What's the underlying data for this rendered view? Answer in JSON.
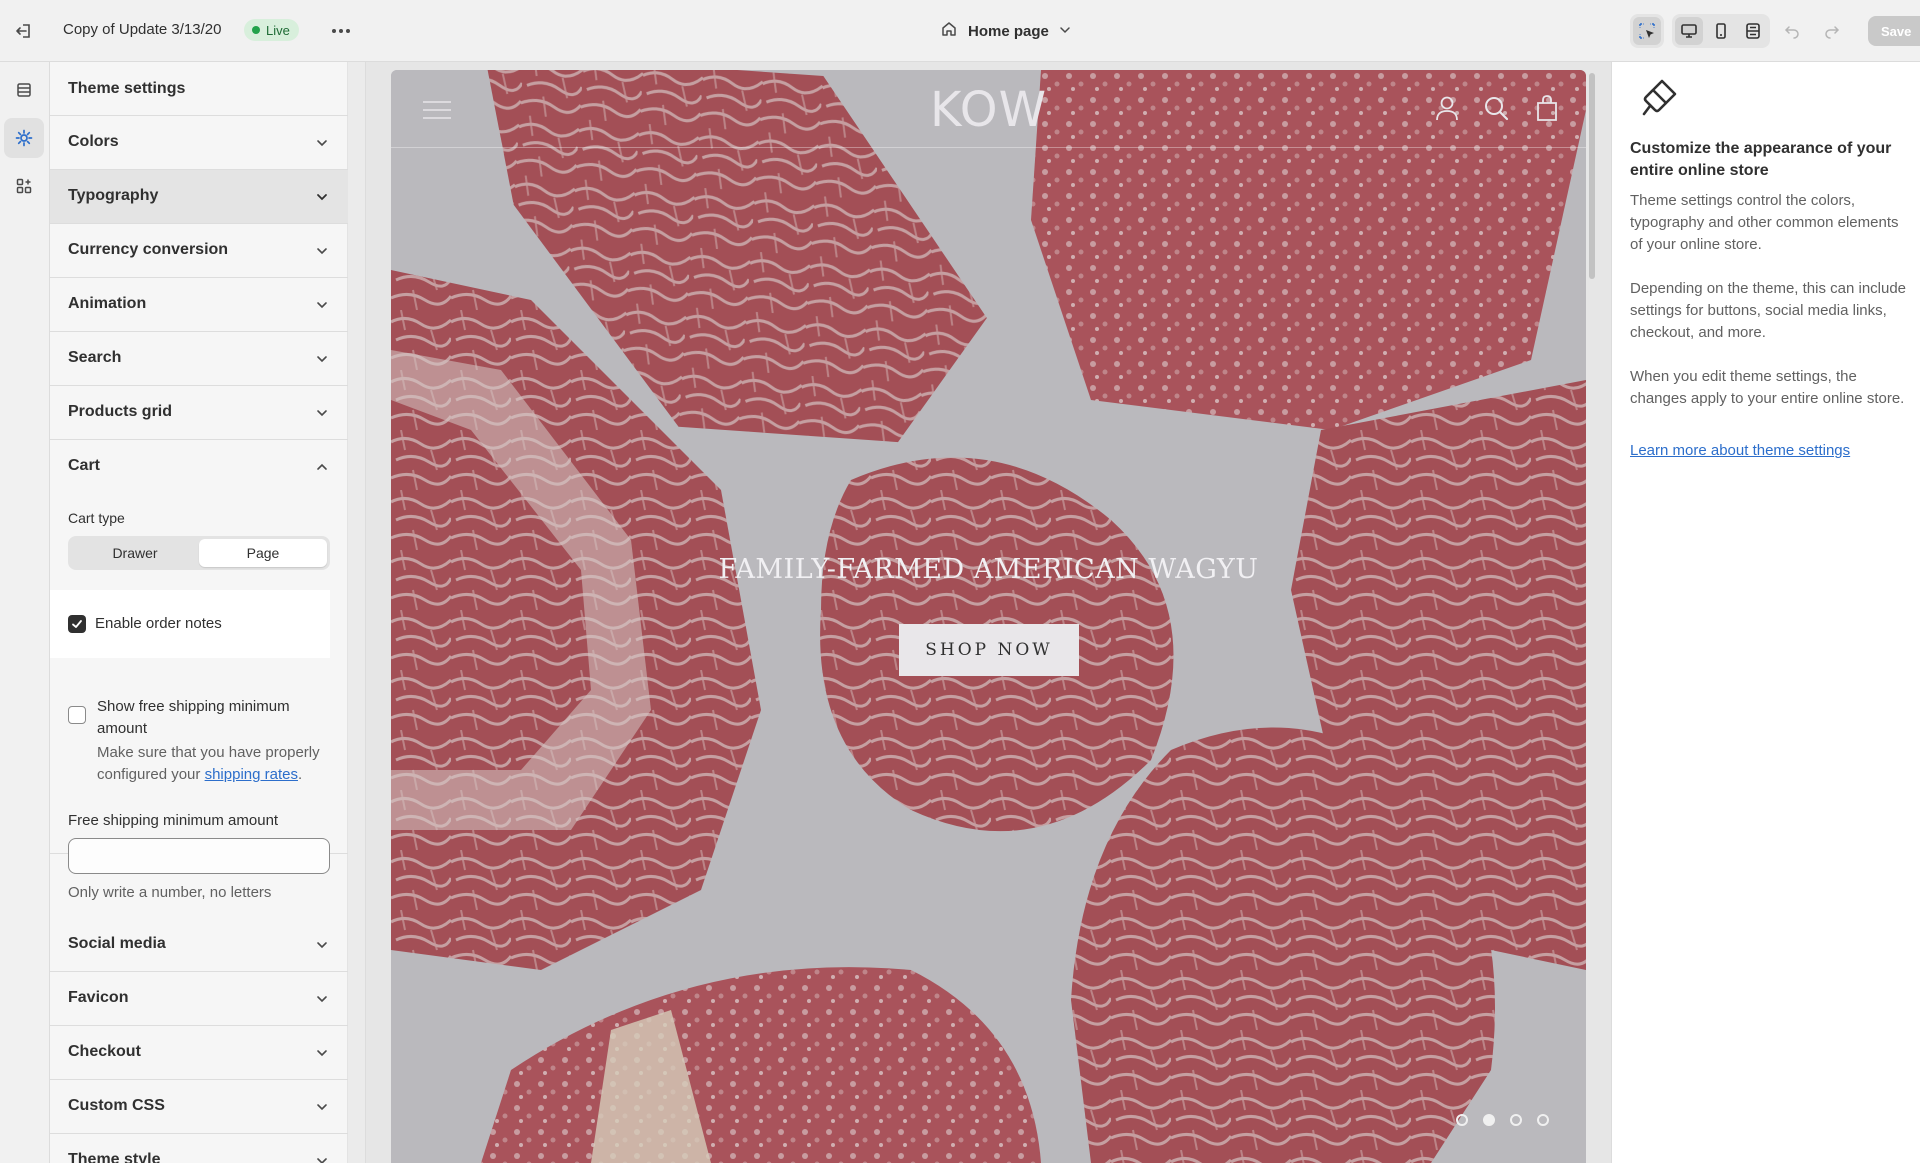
{
  "topbar": {
    "theme_name": "Copy of Update 3/13/20",
    "live_badge": "Live",
    "page_picker": "Home page",
    "save_label": "Save",
    "icons": [
      "exit-icon",
      "more-icon",
      "home-icon",
      "chevron-down-icon",
      "inspector-icon",
      "desktop-icon",
      "mobile-icon",
      "fullwidth-icon",
      "undo-icon",
      "redo-icon"
    ]
  },
  "rail": {
    "items": [
      {
        "name": "sections",
        "icon": "sections-icon"
      },
      {
        "name": "theme-settings",
        "icon": "gear-icon",
        "active": true
      },
      {
        "name": "apps",
        "icon": "apps-icon"
      }
    ]
  },
  "panel": {
    "title": "Theme settings",
    "sections_top": [
      {
        "label": "Colors"
      },
      {
        "label": "Typography"
      },
      {
        "label": "Currency conversion"
      },
      {
        "label": "Animation"
      },
      {
        "label": "Search"
      },
      {
        "label": "Products grid"
      }
    ],
    "cart": {
      "label": "Cart",
      "cart_type_label": "Cart type",
      "cart_type_options": [
        "Drawer",
        "Page"
      ],
      "cart_type_selected": "Page",
      "order_notes_label": "Enable order notes",
      "order_notes_checked": true,
      "free_shipping_label": "Show free shipping minimum amount",
      "free_shipping_checked": false,
      "free_shipping_help_prefix": "Make sure that you have properly configured your ",
      "free_shipping_help_link": "shipping rates",
      "free_shipping_help_suffix": ".",
      "amount_label": "Free shipping minimum amount",
      "amount_value": "",
      "amount_help": "Only write a number, no letters"
    },
    "sections_bottom": [
      {
        "label": "Social media"
      },
      {
        "label": "Favicon"
      },
      {
        "label": "Checkout"
      },
      {
        "label": "Custom CSS"
      },
      {
        "label": "Theme style"
      }
    ]
  },
  "preview": {
    "logo": "KOW",
    "hero_title": "FAMILY-FARMED AMERICAN WAGYU",
    "hero_button": "SHOP NOW",
    "slide_count": 4,
    "active_slide": 2
  },
  "info": {
    "heading": "Customize the appearance of your entire online store",
    "p1": "Theme settings control the colors, typography and other common elements of your online store.",
    "p2": "Depending on the theme, this can include settings for buttons, social media links, checkout, and more.",
    "p3": "When you edit theme settings, the changes apply to your entire online store.",
    "link": "Learn more about theme settings"
  },
  "colors": {
    "accent_link": "#2c6ecb",
    "live_green": "#22a24b",
    "meat_red": "#a8343e"
  }
}
